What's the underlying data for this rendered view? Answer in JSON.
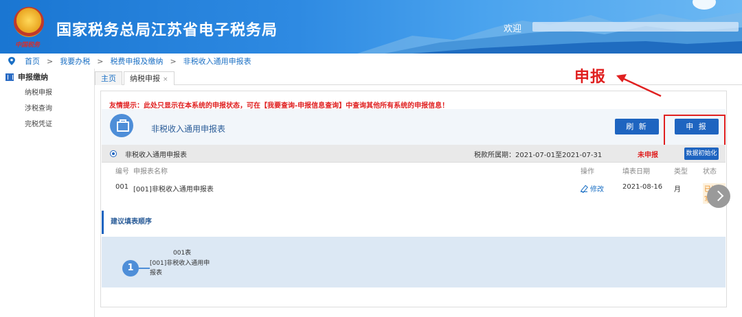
{
  "header": {
    "emblem_text": "中国税务",
    "title": "国家税务总局江苏省电子税务局",
    "welcome": "欢迎"
  },
  "breadcrumb": {
    "items": [
      "首页",
      "我要办税",
      "税费申报及缴纳",
      "非税收入通用申报表"
    ],
    "separator": ">"
  },
  "sidebar": {
    "section": "申报缴纳",
    "items": [
      "纳税申报",
      "涉税查询",
      "完税凭证"
    ]
  },
  "tabs": [
    {
      "label": "主页"
    },
    {
      "label": "纳税申报",
      "close": "×"
    }
  ],
  "main": {
    "notice": "友情提示：此处只显示在本系统的申报状态，可在【我要查询-申报信息查询】中查询其他所有系统的申报信息！",
    "form_title": "非税收入通用申报表",
    "refresh_label": "刷 新",
    "declare_label": "申 报",
    "status_row": {
      "name": "非税收入通用申报表",
      "period": "税款所属期：2021-07-01至2021-07-31",
      "status": "未申报",
      "init_label": "数据初始化"
    },
    "table": {
      "headers": {
        "no": "编号",
        "name": "申报表名称",
        "op": "操作",
        "date": "填表日期",
        "type": "类型",
        "status": "状态"
      },
      "rows": [
        {
          "no": "001",
          "name": "[001]非税收入通用申报表",
          "op": "修改",
          "date": "2021-08-16",
          "type": "月",
          "status": "已填写"
        }
      ]
    },
    "order": {
      "title": "建议填表顺序",
      "steps": [
        {
          "num": "1",
          "code": "001表",
          "name": "[001]非税收入通用申报表"
        }
      ]
    }
  },
  "annotation": {
    "label": "申报",
    "color": "#e02020"
  },
  "colors": {
    "primary": "#1e64c0",
    "header": "#1a76d2",
    "alert": "#e02020"
  }
}
